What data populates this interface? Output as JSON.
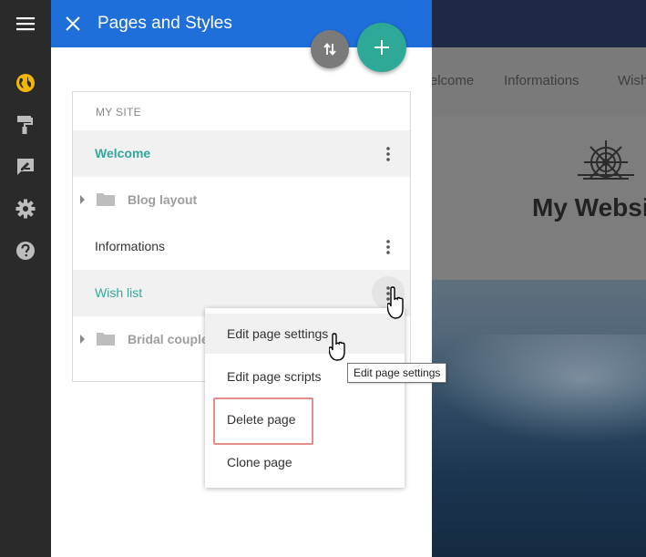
{
  "panel": {
    "title": "Pages and Styles",
    "section_label": "MY SITE",
    "pages": [
      {
        "label": "Welcome",
        "type": "page",
        "state": "selected"
      },
      {
        "label": "Blog layout",
        "type": "folder",
        "state": "collapsed"
      },
      {
        "label": "Informations",
        "type": "page",
        "state": "normal"
      },
      {
        "label": "Wish list",
        "type": "page",
        "state": "active-menu"
      },
      {
        "label": "Bridal couple",
        "type": "folder",
        "state": "collapsed"
      }
    ]
  },
  "context_menu": {
    "items": [
      {
        "label": "Edit page settings"
      },
      {
        "label": "Edit page scripts"
      },
      {
        "label": "Delete page"
      },
      {
        "label": "Clone page"
      }
    ],
    "tooltip": "Edit page settings"
  },
  "preview": {
    "menu": [
      "Welcome",
      "Informations",
      "Wish list"
    ],
    "site_title": "My Website"
  },
  "rail_icons": [
    "menu-icon",
    "globe-icon",
    "paint-roller-icon",
    "edit-icon",
    "gear-icon",
    "help-icon"
  ],
  "colors": {
    "panel_header": "#1e6fd9",
    "accent_teal": "#34a89b",
    "fab_add": "#2ea897",
    "fab_sort": "#7a7a7a",
    "rail": "#2a2a2a",
    "globe": "#f2b705",
    "delete_highlight": "#e58c8c"
  }
}
